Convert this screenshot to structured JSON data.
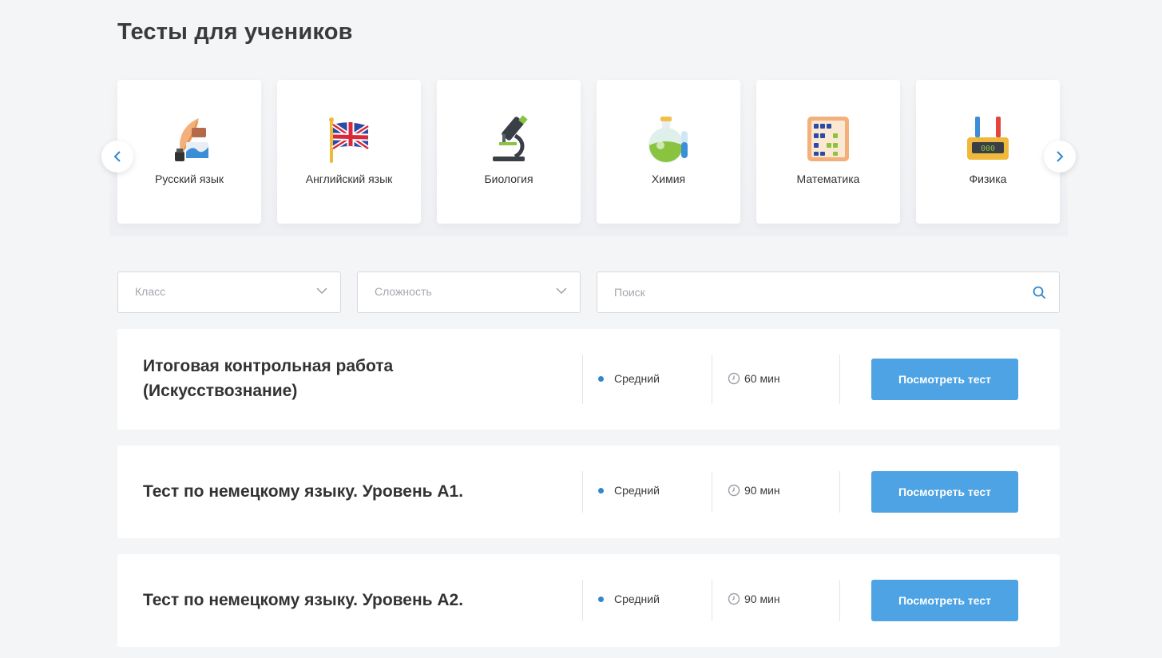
{
  "page": {
    "title": "Тесты для учеников"
  },
  "subjects": [
    {
      "label": "Русский язык",
      "icon": "quill-inkwell-icon"
    },
    {
      "label": "Английский язык",
      "icon": "uk-flag-icon"
    },
    {
      "label": "Биология",
      "icon": "microscope-icon"
    },
    {
      "label": "Химия",
      "icon": "chemistry-flask-icon"
    },
    {
      "label": "Математика",
      "icon": "abacus-icon"
    },
    {
      "label": "Физика",
      "icon": "battery-meter-icon"
    }
  ],
  "filters": {
    "class_placeholder": "Класс",
    "difficulty_placeholder": "Сложность",
    "search_placeholder": "Поиск"
  },
  "tests": [
    {
      "title": "Итоговая контрольная работа (Искусствознание)",
      "level": "Средний",
      "duration": "60 мин",
      "button": "Посмотреть тест"
    },
    {
      "title": "Тест по немецкому языку. Уровень А1.",
      "level": "Средний",
      "duration": "90 мин",
      "button": "Посмотреть тест"
    },
    {
      "title": "Тест по немецкому языку. Уровень А2.",
      "level": "Средний",
      "duration": "90 мин",
      "button": "Посмотреть тест"
    }
  ],
  "colors": {
    "accent": "#4da3e4",
    "level_dot": "#2f87cf",
    "background": "#f4f5f7"
  }
}
